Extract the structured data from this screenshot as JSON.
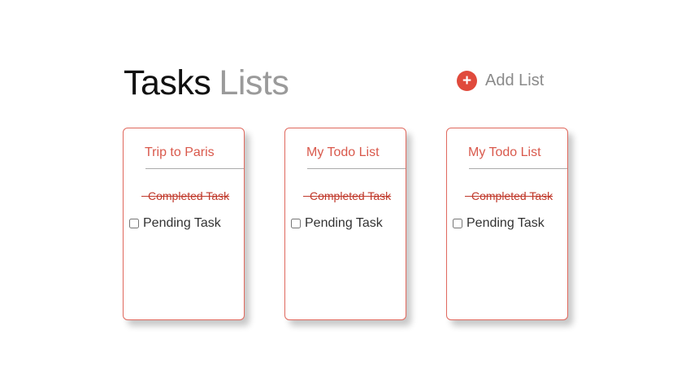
{
  "header": {
    "title_primary": "Tasks",
    "title_secondary": "Lists"
  },
  "add_list": {
    "icon": "plus-circle-icon",
    "label": "Add List"
  },
  "lists": [
    {
      "title": "Trip to Paris",
      "completed_task": "Completed Task",
      "pending_task": "Pending Task"
    },
    {
      "title": "My Todo List",
      "completed_task": "Completed Task",
      "pending_task": "Pending Task"
    },
    {
      "title": "My Todo List",
      "completed_task": "Completed Task",
      "pending_task": "Pending Task"
    }
  ],
  "colors": {
    "accent": "#e04a3c",
    "card_border": "#e0695e",
    "muted_text": "#9a9a9a"
  }
}
